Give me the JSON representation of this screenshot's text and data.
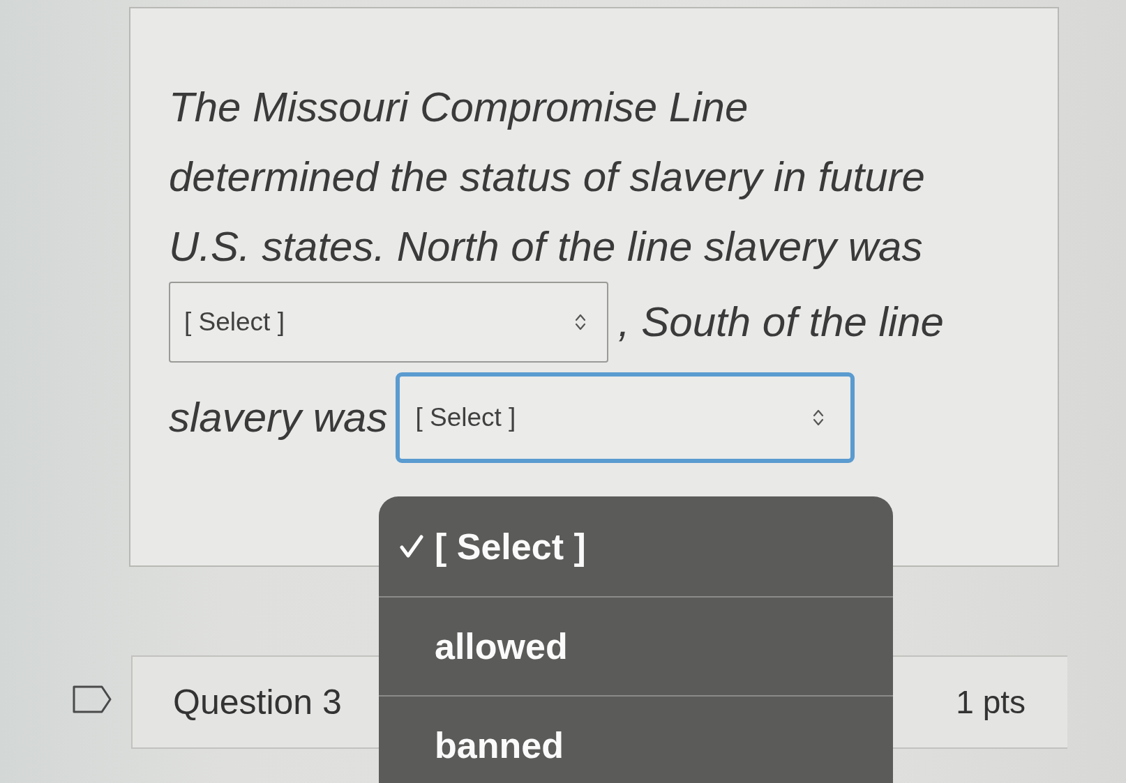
{
  "question_card": {
    "lines": [
      [
        {
          "kind": "text",
          "text": "The Missouri Compromise Line"
        }
      ],
      [
        {
          "kind": "text",
          "text": "determined the status of slavery in future"
        }
      ],
      [
        {
          "kind": "text",
          "text": "U.S. states. North of the line slavery was"
        }
      ],
      [
        {
          "kind": "select",
          "value": "[ Select ]",
          "focused": false
        },
        {
          "kind": "text",
          "text": ", South of the line"
        }
      ],
      [
        {
          "kind": "text",
          "text": "slavery was"
        },
        {
          "kind": "select",
          "value": "[ Select ]",
          "focused": true
        }
      ]
    ]
  },
  "dropdown_menu": {
    "options": [
      {
        "label": "[ Select ]",
        "selected": true
      },
      {
        "label": "allowed",
        "selected": false
      },
      {
        "label": "banned",
        "selected": false
      }
    ]
  },
  "next_question": {
    "title": "Question 3",
    "points": "1 pts"
  }
}
